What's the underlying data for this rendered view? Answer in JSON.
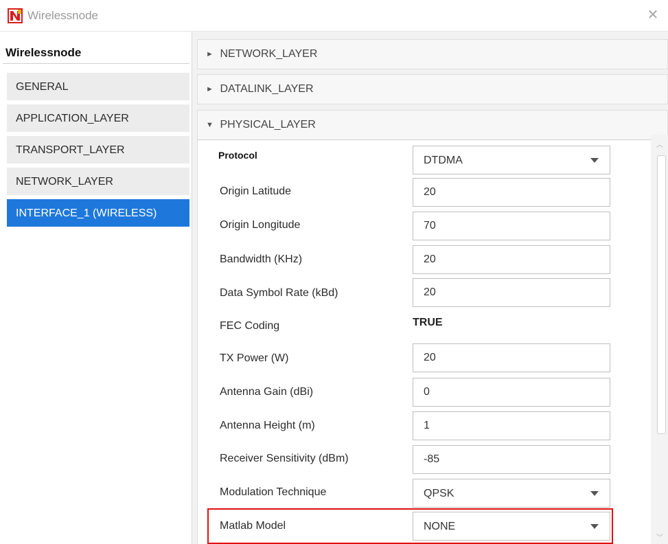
{
  "window": {
    "title": "Wirelessnode",
    "logo_icon": "netsim-logo-icon",
    "close_icon": "close-icon"
  },
  "sidebar": {
    "header": "Wirelessnode",
    "items": [
      {
        "label": "GENERAL",
        "active": false
      },
      {
        "label": "APPLICATION_LAYER",
        "active": false
      },
      {
        "label": "TRANSPORT_LAYER",
        "active": false
      },
      {
        "label": "NETWORK_LAYER",
        "active": false
      },
      {
        "label": "INTERFACE_1 (WIRELESS)",
        "active": true
      }
    ],
    "active_color": "#1e78dc"
  },
  "sections": {
    "network_layer": {
      "label": "NETWORK_LAYER",
      "expanded": false,
      "arrow": "►"
    },
    "datalink_layer": {
      "label": "DATALINK_LAYER",
      "expanded": false,
      "arrow": "►"
    },
    "physical_layer": {
      "label": "PHYSICAL_LAYER",
      "expanded": true,
      "arrow": "▼"
    }
  },
  "physical_layer": {
    "protocol": {
      "label": "Protocol",
      "value": "DTDMA"
    },
    "origin_latitude": {
      "label": "Origin Latitude",
      "value": "20"
    },
    "origin_longitude": {
      "label": "Origin Longitude",
      "value": "70"
    },
    "bandwidth": {
      "label": "Bandwidth (KHz)",
      "value": "20"
    },
    "data_symbol_rate": {
      "label": "Data Symbol Rate (kBd)",
      "value": "20"
    },
    "fec_coding": {
      "label": "FEC Coding",
      "value": "TRUE"
    },
    "tx_power": {
      "label": "TX Power (W)",
      "value": "20"
    },
    "antenna_gain": {
      "label": "Antenna Gain (dBi)",
      "value": "0"
    },
    "antenna_height": {
      "label": "Antenna Height (m)",
      "value": "1"
    },
    "receiver_sensitivity": {
      "label": "Receiver Sensitivity (dBm)",
      "value": "-85"
    },
    "modulation_technique": {
      "label": "Modulation Technique",
      "value": "QPSK"
    },
    "matlab_model": {
      "label": "Matlab Model",
      "value": "NONE"
    }
  },
  "highlight_color": "#e01010"
}
